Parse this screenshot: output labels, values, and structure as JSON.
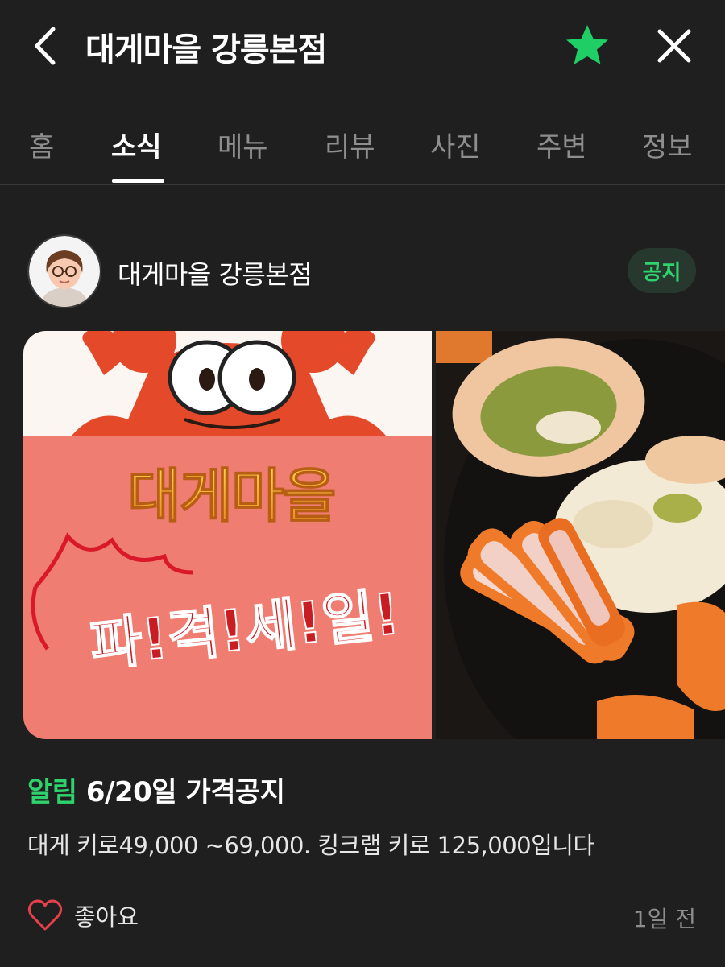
{
  "header": {
    "title": "대게마을 강릉본점",
    "back_icon": "chevron-left-icon",
    "favorite_icon": "star-icon",
    "close_icon": "close-icon",
    "favorite_color": "#1fce64"
  },
  "tabs": [
    {
      "label": "홈",
      "active": false
    },
    {
      "label": "소식",
      "active": true
    },
    {
      "label": "메뉴",
      "active": false
    },
    {
      "label": "리뷰",
      "active": false
    },
    {
      "label": "사진",
      "active": false
    },
    {
      "label": "주변",
      "active": false
    },
    {
      "label": "정보",
      "active": false
    }
  ],
  "post": {
    "author": "대게마을 강릉본점",
    "badge": "공지",
    "images": [
      {
        "type": "promo",
        "headline": "대게마을",
        "subline": "파!격!세!일!"
      },
      {
        "type": "photo",
        "subject": "crab-dish"
      }
    ],
    "title_tag": "알림",
    "title": "6/20일 가격공지",
    "body": "대게 키로49,000 ~69,000. 킹크랩 키로 125,000입니다",
    "like_label": "좋아요",
    "time": "1일 전"
  },
  "colors": {
    "background": "#1f1f1f",
    "accent_green": "#2fd36d",
    "muted": "#8e8e8e"
  }
}
